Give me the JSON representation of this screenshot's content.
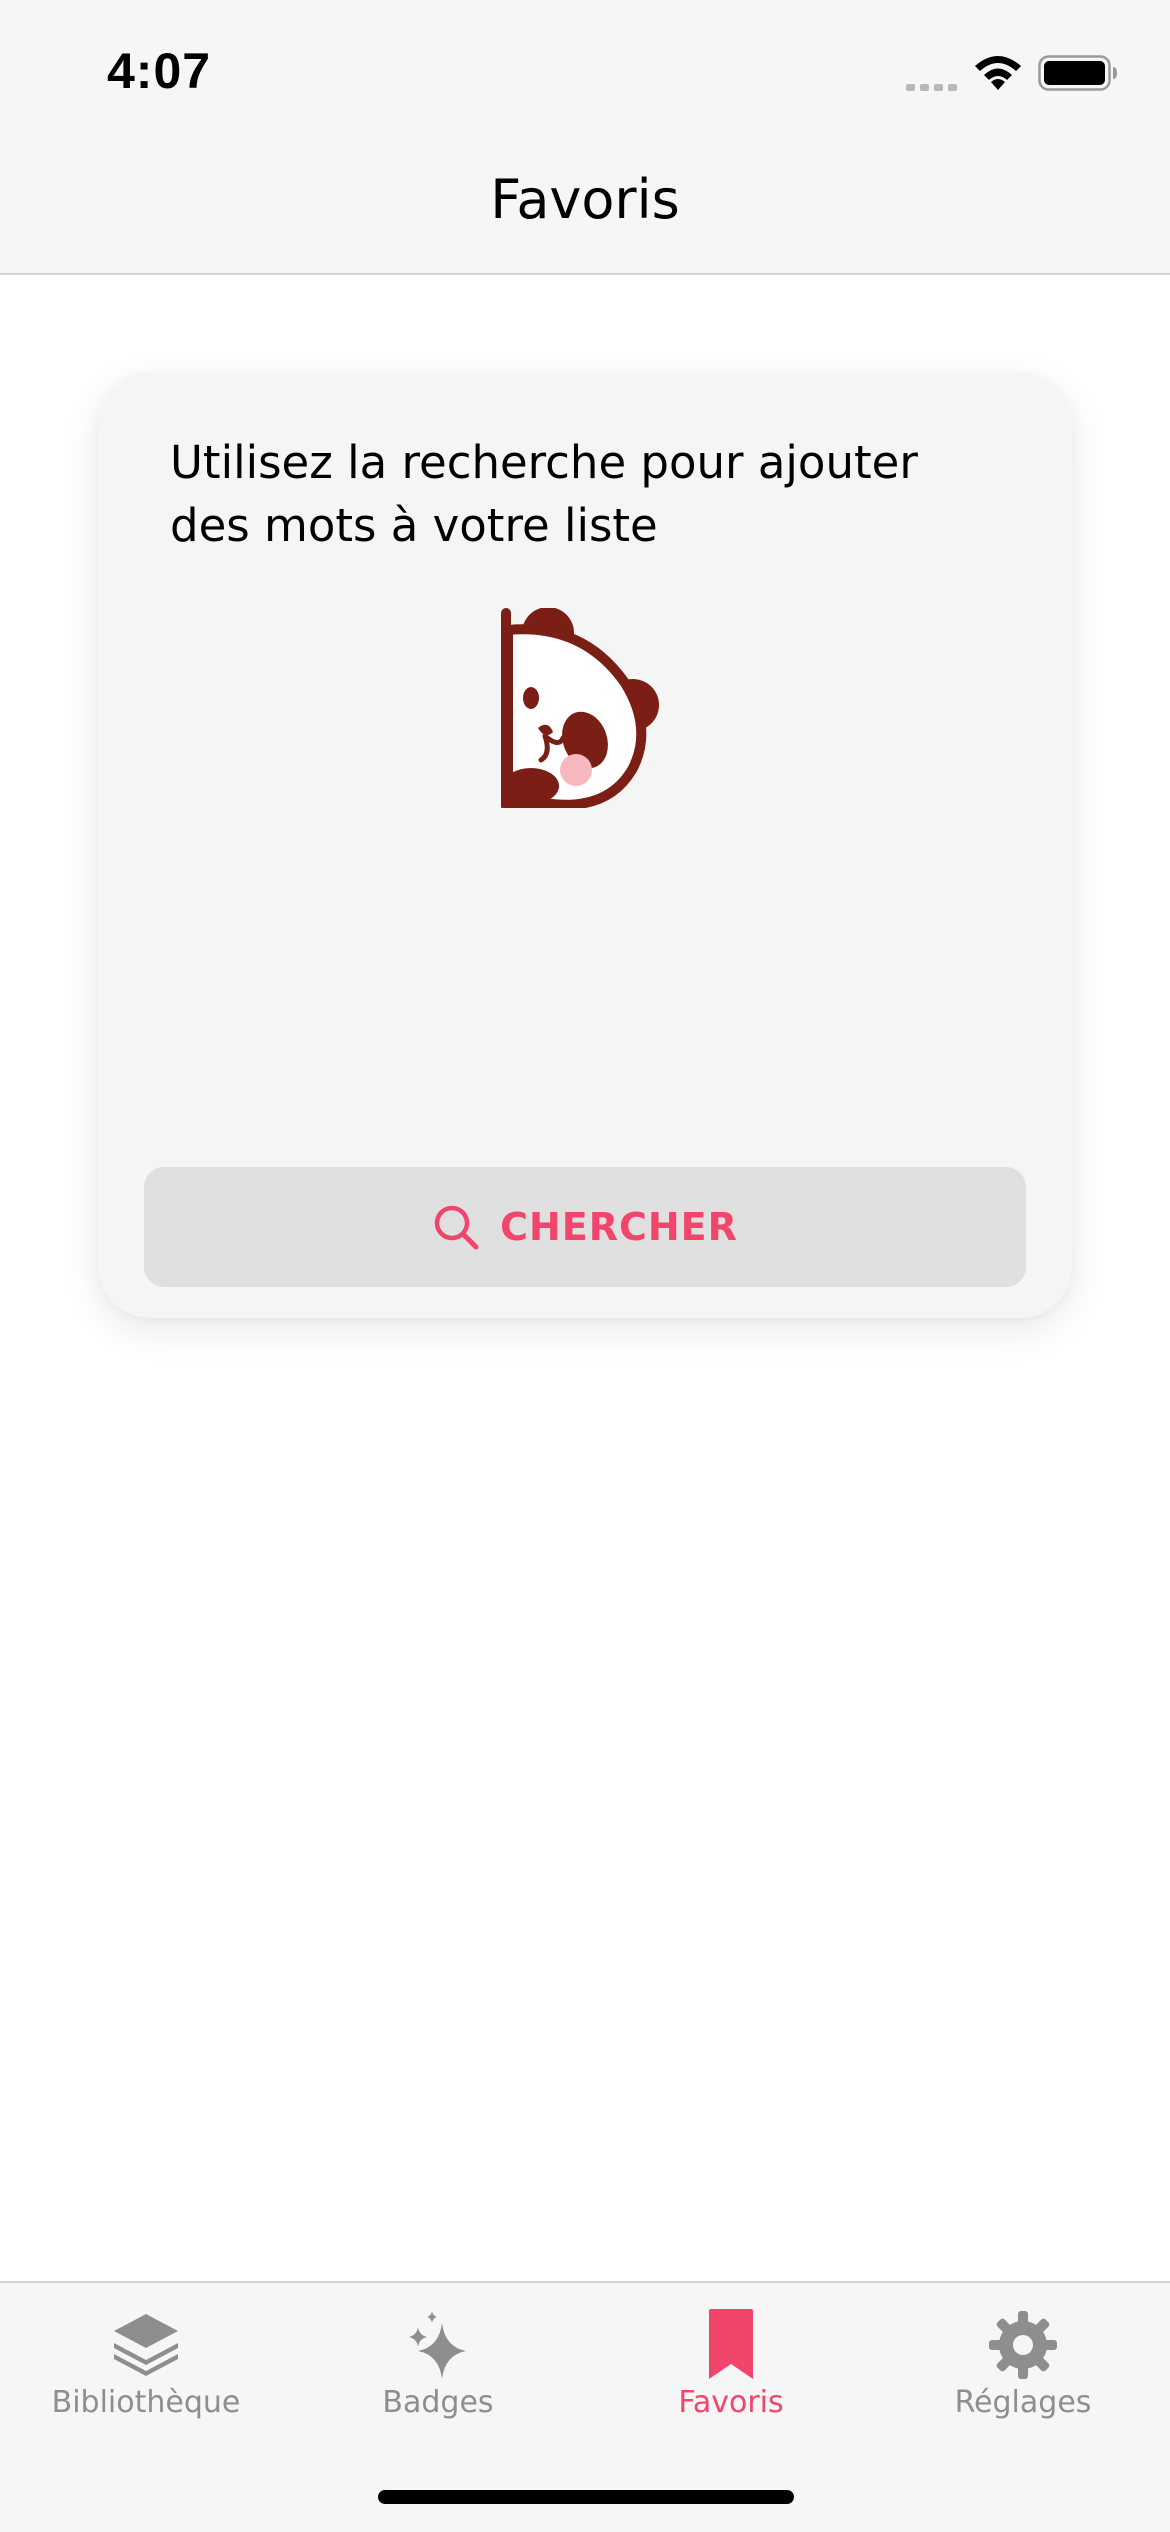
{
  "status_bar": {
    "time": "4:07",
    "icons": [
      "signal-icon",
      "wifi-icon",
      "battery-icon"
    ]
  },
  "header": {
    "title": "Favoris"
  },
  "card": {
    "message": "Utilisez la recherche pour ajouter des mots à votre liste",
    "illustration": "panda-peeking-illustration",
    "search_button": {
      "label": "CHERCHER",
      "icon": "search-icon"
    }
  },
  "tab_bar": {
    "items": [
      {
        "label": "Bibliothèque",
        "icon": "layers-icon",
        "active": false
      },
      {
        "label": "Badges",
        "icon": "sparkles-icon",
        "active": false
      },
      {
        "label": "Favoris",
        "icon": "bookmark-icon",
        "active": true
      },
      {
        "label": "Réglages",
        "icon": "gear-icon",
        "active": false
      }
    ]
  },
  "colors": {
    "accent": "#f2456b",
    "inactive": "#8e8e8e",
    "bar_background": "#f6f6f6",
    "card_background": "#f5f5f5",
    "button_background": "#e0e0e0",
    "panda_brown": "#7a1e16",
    "panda_blush": "#f7b8c0"
  }
}
